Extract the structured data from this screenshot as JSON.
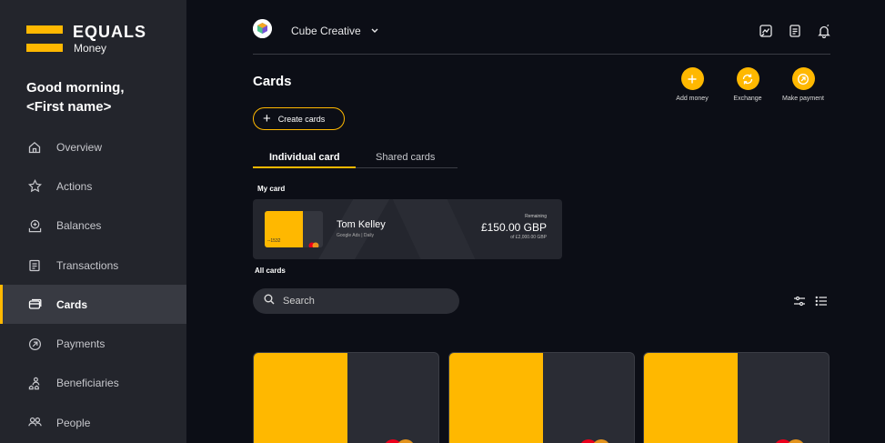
{
  "brand": {
    "name": "EQUALS",
    "sub": "Money",
    "accent": "#ffb800"
  },
  "greeting": {
    "line1": "Good morning,",
    "line2": "<First name>"
  },
  "sidebar": {
    "items": [
      {
        "label": "Overview",
        "icon": "home-icon"
      },
      {
        "label": "Actions",
        "icon": "star-icon"
      },
      {
        "label": "Balances",
        "icon": "balances-icon"
      },
      {
        "label": "Transactions",
        "icon": "receipt-icon"
      },
      {
        "label": "Cards",
        "icon": "card-icon",
        "active": true
      },
      {
        "label": "Payments",
        "icon": "payment-arrow-icon"
      },
      {
        "label": "Beneficiaries",
        "icon": "beneficiaries-icon"
      },
      {
        "label": "People",
        "icon": "people-icon"
      }
    ]
  },
  "topbar": {
    "org_name": "Cube Creative"
  },
  "page": {
    "title": "Cards"
  },
  "quick_actions": [
    {
      "label": "Add money",
      "icon": "plus-icon"
    },
    {
      "label": "Exchange",
      "icon": "exchange-icon"
    },
    {
      "label": "Make payment",
      "icon": "send-icon"
    }
  ],
  "create_button": {
    "label": "Create cards"
  },
  "tabs": [
    {
      "label": "Individual card",
      "active": true
    },
    {
      "label": "Shared cards"
    }
  ],
  "my_card": {
    "section_label": "My card",
    "holder": "Tom Kelley",
    "sub": "Google Ads | Daily",
    "last4": "--1532",
    "remaining_label": "Remaining",
    "remaining_amount": "£150.00 GBP",
    "limit": "of £2,000.00 GBP"
  },
  "all_cards": {
    "section_label": "All cards"
  },
  "search": {
    "placeholder": "Search"
  }
}
